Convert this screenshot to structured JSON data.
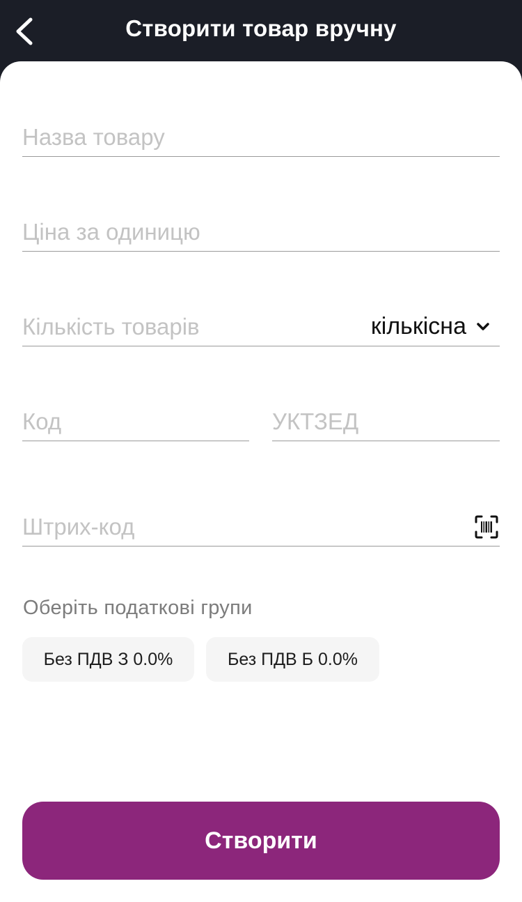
{
  "header": {
    "title": "Створити товар вручну"
  },
  "form": {
    "name_placeholder": "Назва товару",
    "price_placeholder": "Ціна за одиницю",
    "quantity_placeholder": "Кількість товарів",
    "quantity_unit": "кількісна",
    "code_placeholder": "Код",
    "uktzed_placeholder": "УКТЗЕД",
    "barcode_placeholder": "Штрих-код"
  },
  "tax": {
    "label": "Оберіть податкові групи",
    "groups": [
      {
        "label": "Без ПДВ З 0.0%"
      },
      {
        "label": "Без ПДВ Б 0.0%"
      }
    ]
  },
  "actions": {
    "create_label": "Створити"
  },
  "colors": {
    "header_bg": "#1b1e27",
    "accent": "#8c267b",
    "chip_bg": "#f5f5f5"
  }
}
